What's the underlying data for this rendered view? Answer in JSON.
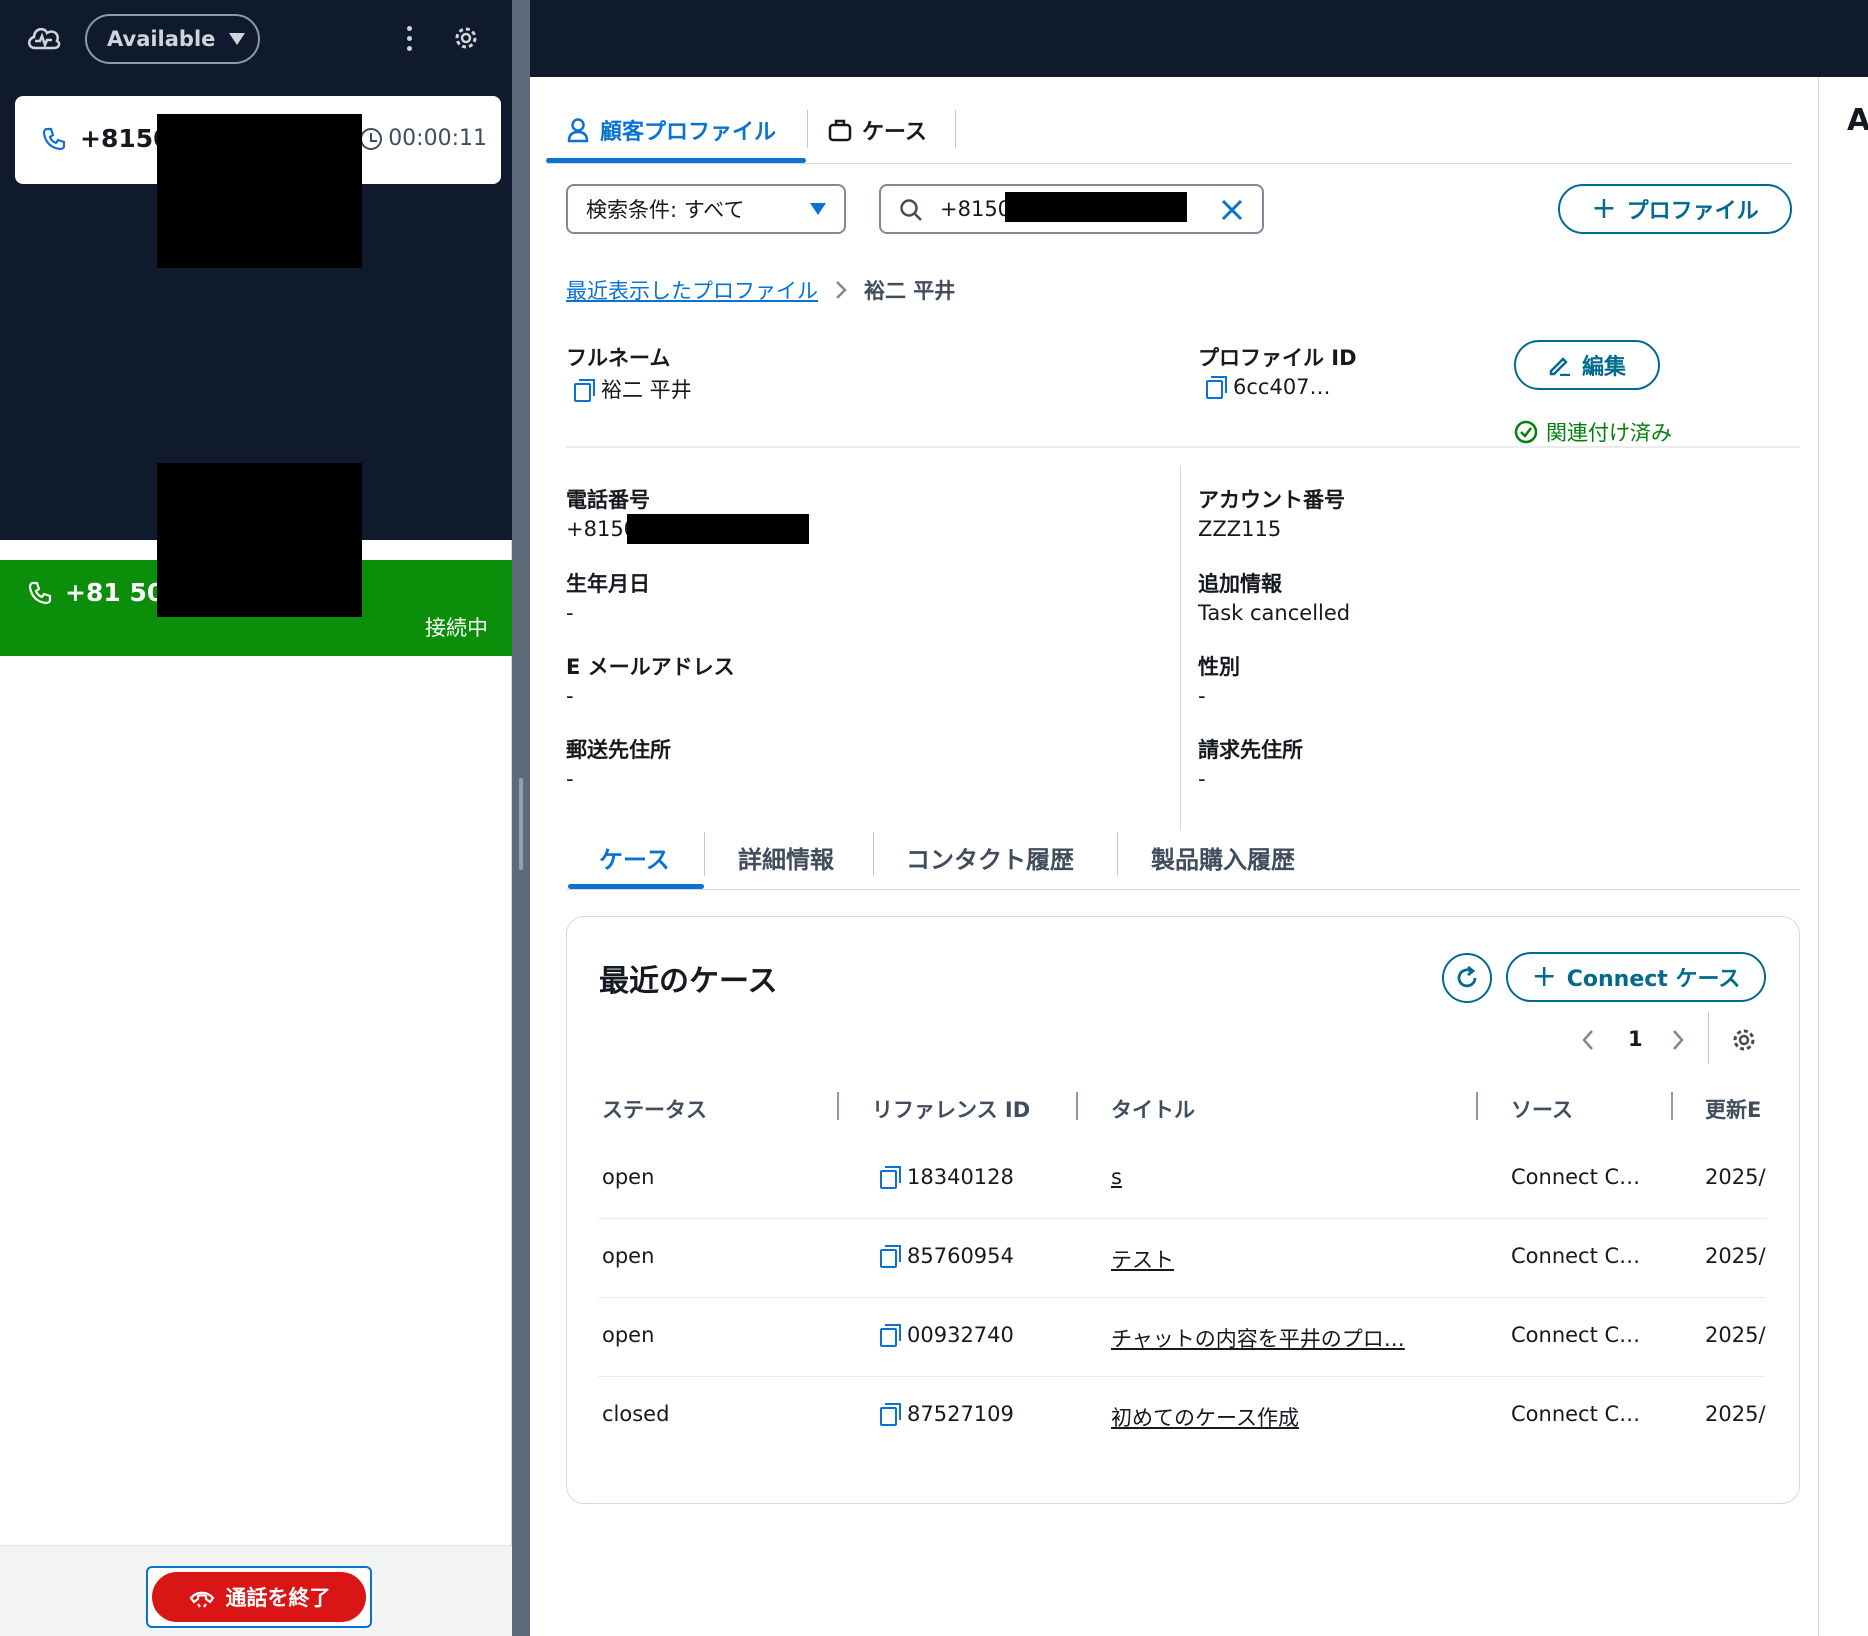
{
  "ccp": {
    "status": "Available",
    "contact_card": {
      "phone": "+8150",
      "timer": "00:00:11"
    },
    "active_call": {
      "phone": "+81 50-",
      "state": "接続中"
    },
    "end_call_label": "通話を終了"
  },
  "tabs": [
    {
      "label": "顧客プロファイル",
      "active": true
    },
    {
      "label": "ケース",
      "active": false
    }
  ],
  "search": {
    "filter_label": "検索条件: すべて",
    "query": "+81505"
  },
  "add_profile_label": "プロファイル",
  "breadcrumb": {
    "parent": "最近表示したプロファイル",
    "current": "裕二 平井"
  },
  "profile": {
    "full_name_label": "フルネーム",
    "full_name": "裕二 平井",
    "profile_id_label": "プロファイル ID",
    "profile_id": "6cc407…",
    "edit_label": "編集",
    "associated_label": "関連付け済み",
    "fields_left": [
      {
        "label": "電話番号",
        "value": "+8150"
      },
      {
        "label": "生年月日",
        "value": "-"
      },
      {
        "label": "E メールアドレス",
        "value": "-"
      },
      {
        "label": "郵送先住所",
        "value": "-"
      }
    ],
    "fields_right": [
      {
        "label": "アカウント番号",
        "value": "ZZZ115"
      },
      {
        "label": "追加情報",
        "value": "Task cancelled"
      },
      {
        "label": "性別",
        "value": "-"
      },
      {
        "label": "請求先住所",
        "value": "-"
      }
    ]
  },
  "subtabs": [
    "ケース",
    "詳細情報",
    "コンタクト履歴",
    "製品購入履歴"
  ],
  "cases": {
    "title": "最近のケース",
    "connect_case_label": "Connect ケース",
    "page": "1",
    "columns": [
      "ステータス",
      "リファレンス ID",
      "タイトル",
      "ソース",
      "更新E"
    ],
    "rows": [
      {
        "status": "open",
        "ref": "18340128",
        "title": "s",
        "source": "Connect C…",
        "updated": "2025/"
      },
      {
        "status": "open",
        "ref": "85760954",
        "title": "テスト",
        "source": "Connect C…",
        "updated": "2025/"
      },
      {
        "status": "open",
        "ref": "00932740",
        "title": "チャットの内容を平井のプロ…",
        "source": "Connect C…",
        "updated": "2025/"
      },
      {
        "status": "closed",
        "ref": "87527109",
        "title": "初めてのケース作成",
        "source": "Connect C…",
        "updated": "2025/"
      }
    ]
  },
  "right_strip_letter": "A"
}
